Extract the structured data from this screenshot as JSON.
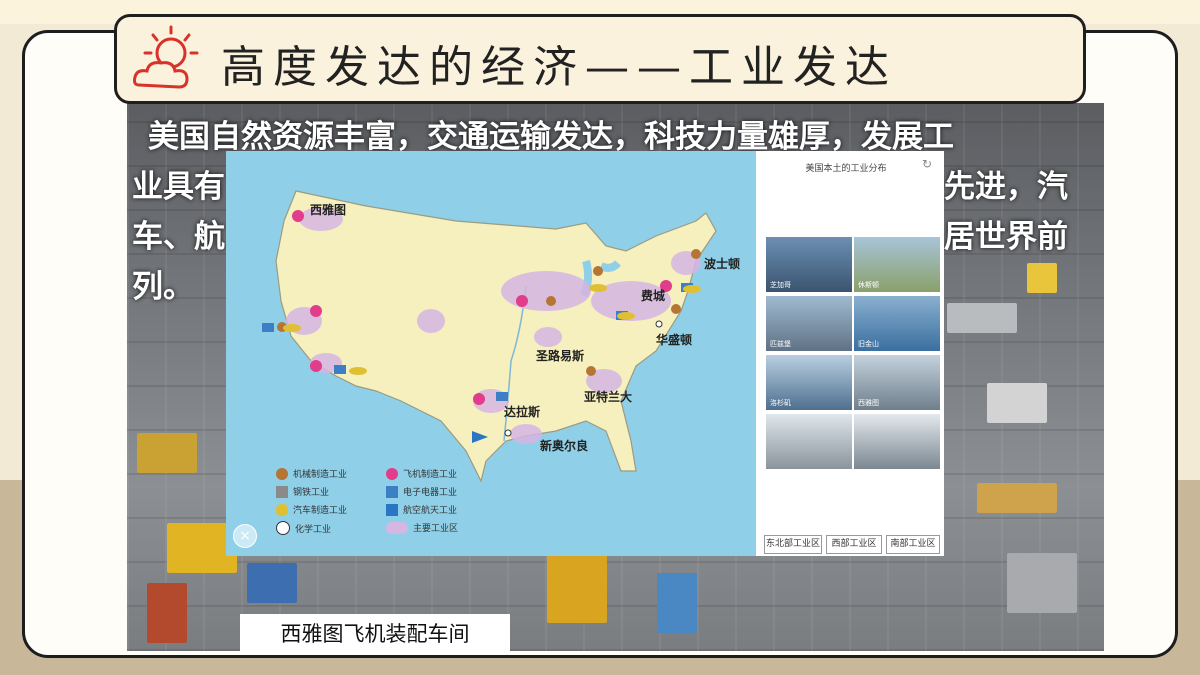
{
  "slide": {
    "title": "高度发达的经济——工业发达",
    "paragraph_lines": [
      "美国自然资源丰富，交通运输发达，科技力量雄厚，发展工",
      "业具有",
      "先进，汽",
      "车、航",
      "居世界前",
      "列。"
    ]
  },
  "map": {
    "city_labels": [
      "西雅图",
      "波士顿",
      "费城",
      "华盛顿",
      "圣路易斯",
      "亚特兰大",
      "达拉斯",
      "新奥尔良"
    ],
    "legend": [
      {
        "icon": "gear-icon",
        "label": "机械制造工业"
      },
      {
        "icon": "airplane-icon",
        "label": "飞机制造工业"
      },
      {
        "icon": "steel-icon",
        "label": "钢铁工业"
      },
      {
        "icon": "electronics-icon",
        "label": "电子电器工业"
      },
      {
        "icon": "car-icon",
        "label": "汽车制造工业"
      },
      {
        "icon": "aerospace-icon",
        "label": "航空航天工业"
      },
      {
        "icon": "flask-icon",
        "label": "化学工业"
      },
      {
        "icon": "region-icon",
        "label": "主要工业区"
      }
    ],
    "close_symbol": "×"
  },
  "side_panel": {
    "title": "美国本土的工业分布",
    "refresh_symbol": "↻",
    "thumbnails": [
      "芝加哥",
      "休斯顿",
      "匹兹堡",
      "旧金山",
      "洛杉矶",
      "西雅图",
      "",
      ""
    ],
    "region_buttons": [
      "东北部工业区",
      "西部工业区",
      "南部工业区"
    ]
  },
  "caption": "西雅图飞机装配车间",
  "colors": {
    "ocean": "#8fd0e8",
    "land": "#f6efbe",
    "industrial_region": "#d6b6e3",
    "banner": "#fbf2de",
    "accent_red": "#d8322a"
  }
}
